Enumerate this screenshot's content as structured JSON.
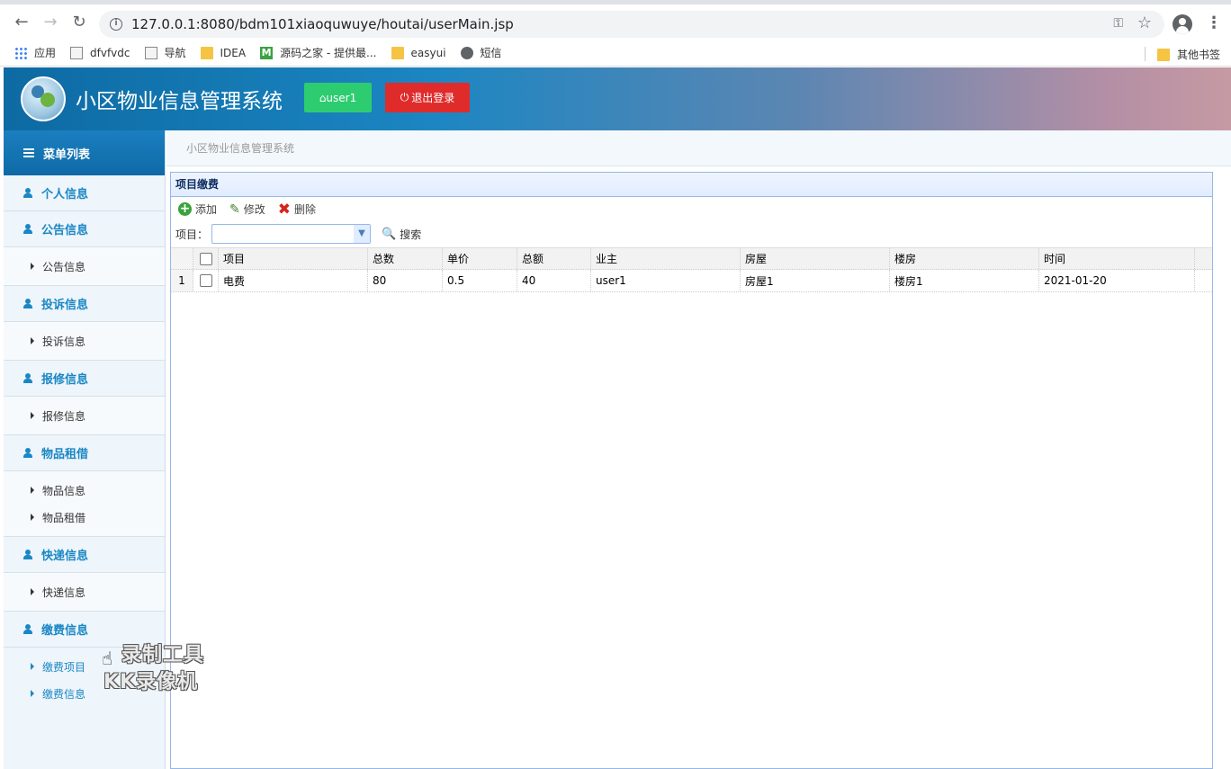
{
  "browser": {
    "url": "127.0.0.1:8080/bdm101xiaoquwuye/houtai/userMain.jsp",
    "bookmarks": [
      {
        "label": "应用",
        "icon": "apps-icon"
      },
      {
        "label": "dfvfvdc",
        "icon": "page-icon"
      },
      {
        "label": "导航",
        "icon": "page-icon"
      },
      {
        "label": "IDEA",
        "icon": "folder-icon"
      },
      {
        "label": "源码之家 - 提供最...",
        "icon": "m-icon"
      },
      {
        "label": "easyui",
        "icon": "folder-icon"
      },
      {
        "label": "短信",
        "icon": "globe-icon"
      }
    ],
    "other_bookmarks": "其他书签"
  },
  "header": {
    "title": "小区物业信息管理系统",
    "user_button": "user1",
    "logout_button": "退出登录"
  },
  "sidebar": {
    "title": "菜单列表",
    "sections": [
      {
        "label": "个人信息",
        "items": []
      },
      {
        "label": "公告信息",
        "items": [
          "公告信息"
        ]
      },
      {
        "label": "投诉信息",
        "items": [
          "投诉信息"
        ]
      },
      {
        "label": "报修信息",
        "items": [
          "报修信息"
        ]
      },
      {
        "label": "物品租借",
        "items": [
          "物品信息",
          "物品租借"
        ]
      },
      {
        "label": "快递信息",
        "items": [
          "快递信息"
        ]
      },
      {
        "label": "缴费信息",
        "items": [
          "缴费项目",
          "缴费信息"
        ]
      }
    ],
    "active_item": "缴费项目"
  },
  "breadcrumb": "小区物业信息管理系统",
  "panel": {
    "title": "项目缴费",
    "toolbar": {
      "add": "添加",
      "edit": "修改",
      "delete": "删除"
    },
    "filter": {
      "label": "项目：",
      "value": "",
      "search": "搜索"
    },
    "columns": [
      "项目",
      "总数",
      "单价",
      "总额",
      "业主",
      "房屋",
      "楼房",
      "时间"
    ],
    "rows": [
      {
        "num": "1",
        "cells": [
          "电费",
          "80",
          "0.5",
          "40",
          "user1",
          "房屋1",
          "楼房1",
          "2021-01-20"
        ]
      }
    ]
  },
  "watermark": {
    "line1": "录制工具",
    "line2": "KK录像机"
  }
}
